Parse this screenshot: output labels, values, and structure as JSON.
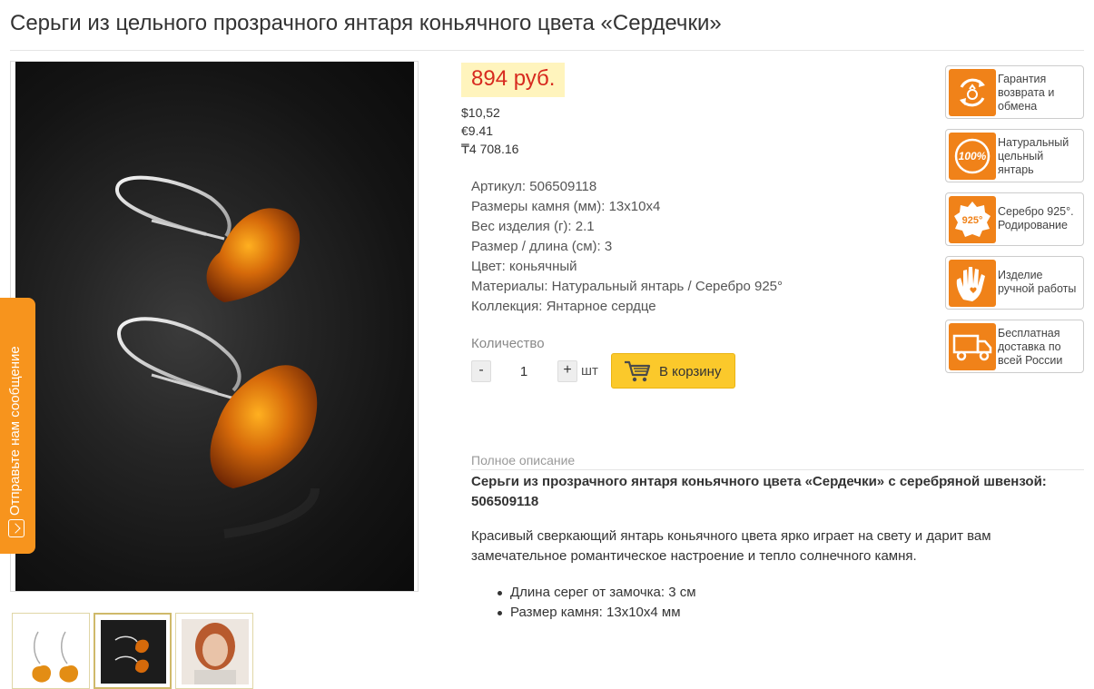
{
  "product": {
    "title": "Серьги из цельного прозрачного янтаря коньячного цвета «Сердечки»",
    "price": "894 руб.",
    "price_usd": "$10,52",
    "price_eur": "€9.41",
    "price_kzt": "₸4 708.16"
  },
  "properties": [
    {
      "label": "Артикул:",
      "value": "506509118"
    },
    {
      "label": "Размеры камня (мм):",
      "value": "13x10x4"
    },
    {
      "label": "Вес изделия (г):",
      "value": "2.1"
    },
    {
      "label": "Размер / длина (см):",
      "value": "3"
    },
    {
      "label": "Цвет:",
      "value": "коньячный"
    },
    {
      "label": "Материалы:",
      "value": "Натуральный янтарь / Серебро 925°"
    },
    {
      "label": "Коллекция:",
      "value": "Янтарное сердце"
    }
  ],
  "quantity": {
    "label": "Количество",
    "minus": "-",
    "value": "1",
    "plus": "+",
    "unit": "шт",
    "cart_button": "В корзину"
  },
  "description": {
    "label": "Полное описание",
    "heading_line1": "Серьги из прозрачного янтаря коньячного цвета «Сердечки» с серебряной швензой:",
    "heading_line2": "506509118",
    "body_line1": "Красивый сверкающий янтарь коньячного цвета ярко играет на свету и дарит вам",
    "body_line2": "замечательное романтическое настроение и тепло солнечного камня.",
    "bullets": [
      "Длина серег от замочка: 3 см",
      "Размер камня: 13x10x4 мм"
    ]
  },
  "features": [
    {
      "icon": "return-exchange-icon",
      "lines": [
        "Гарантия",
        "возврата и",
        "обмена"
      ]
    },
    {
      "icon": "natural-100-badge-icon",
      "badge": "100%",
      "lines": [
        "Натуральный",
        "цельный",
        "янтарь"
      ]
    },
    {
      "icon": "silver-925-badge-icon",
      "badge": "925°",
      "lines": [
        "Серебро 925°.",
        "Родирование"
      ]
    },
    {
      "icon": "handmade-hand-icon",
      "lines": [
        "Изделие",
        "ручной работы"
      ]
    },
    {
      "icon": "delivery-truck-icon",
      "lines": [
        "Бесплатная",
        "доставка по",
        "всей России"
      ]
    }
  ],
  "feedback_tab": {
    "label": "Отправьте нам сообщение",
    "icon": "message-icon"
  },
  "thumbnails": [
    {
      "icon": "earrings-white-thumb",
      "active": false
    },
    {
      "icon": "earrings-dark-thumb",
      "active": true
    },
    {
      "icon": "model-photo-thumb",
      "active": false
    }
  ],
  "colors": {
    "accent": "#f08219",
    "price": "#d72a1f",
    "price_bg": "#fff4bd",
    "cart_button": "#fbc92b"
  }
}
